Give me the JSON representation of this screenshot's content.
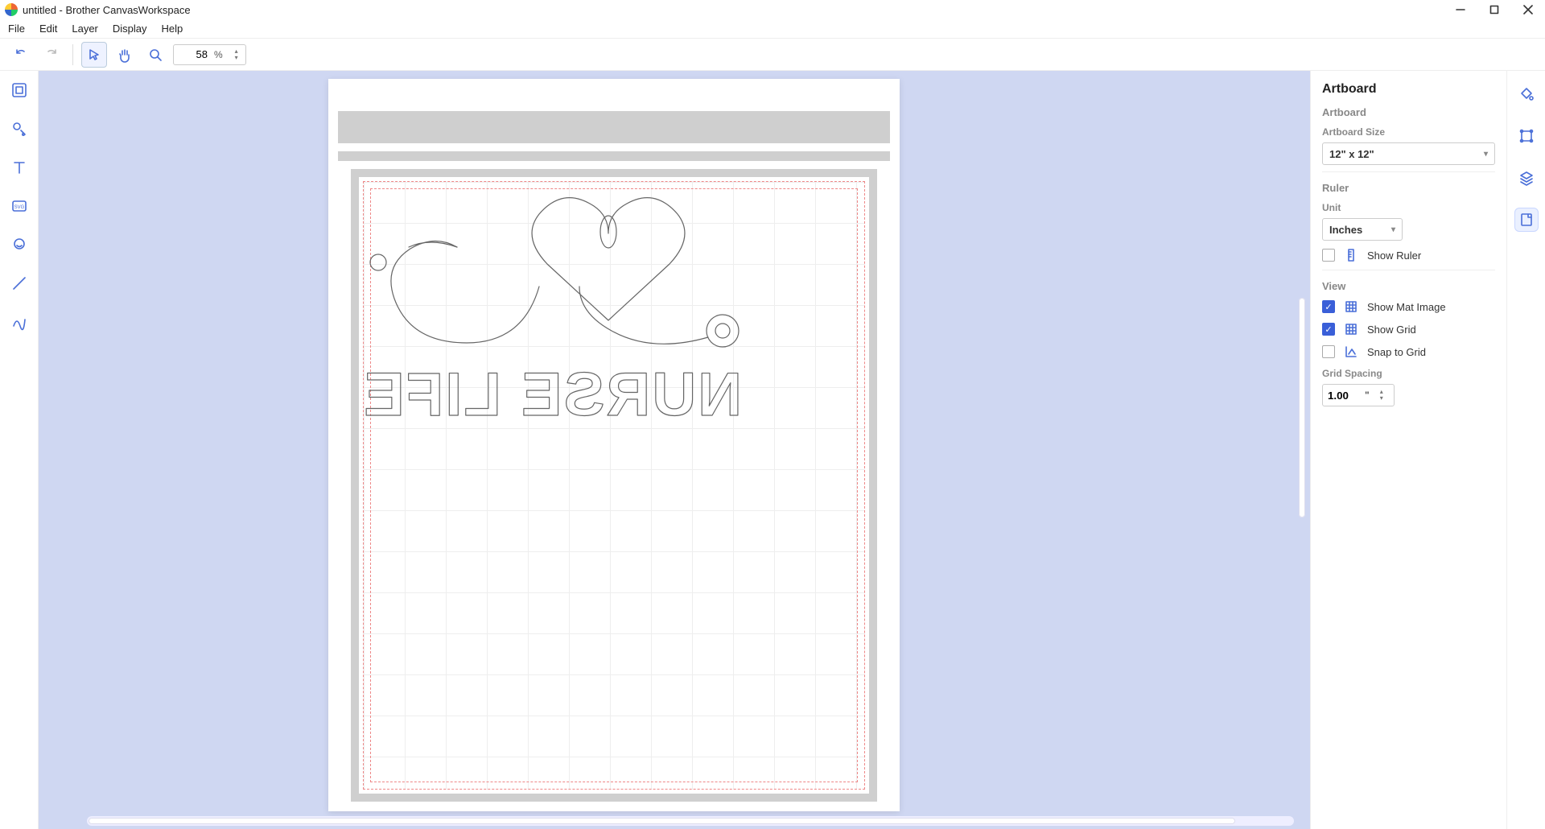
{
  "window": {
    "title": "untitled - Brother CanvasWorkspace"
  },
  "menu": [
    "File",
    "Edit",
    "Layer",
    "Display",
    "Help"
  ],
  "toolbar": {
    "zoom_value": "58",
    "zoom_unit": "%"
  },
  "left_tools": [
    "artboard-tool",
    "shapes-tool",
    "text-tool",
    "svg-import-tool",
    "trace-tool",
    "line-tool",
    "path-tool"
  ],
  "right_tabs": [
    "fill-tab",
    "transform-tab",
    "layers-tab",
    "artboard-tab"
  ],
  "panel": {
    "title": "Artboard",
    "artboard": {
      "section": "Artboard",
      "size_label": "Artboard Size",
      "size_value": "12\" x 12\""
    },
    "ruler": {
      "section": "Ruler",
      "unit_label": "Unit",
      "unit_value": "Inches",
      "show_ruler_label": "Show Ruler",
      "show_ruler_checked": false
    },
    "view": {
      "section": "View",
      "show_mat_label": "Show Mat Image",
      "show_mat_checked": true,
      "show_grid_label": "Show Grid",
      "show_grid_checked": true,
      "snap_label": "Snap to Grid",
      "snap_checked": false,
      "grid_spacing_label": "Grid Spacing",
      "grid_spacing_value": "1.00",
      "grid_spacing_unit": "\""
    }
  },
  "canvas": {
    "design_text": "NURSE LIFE"
  }
}
